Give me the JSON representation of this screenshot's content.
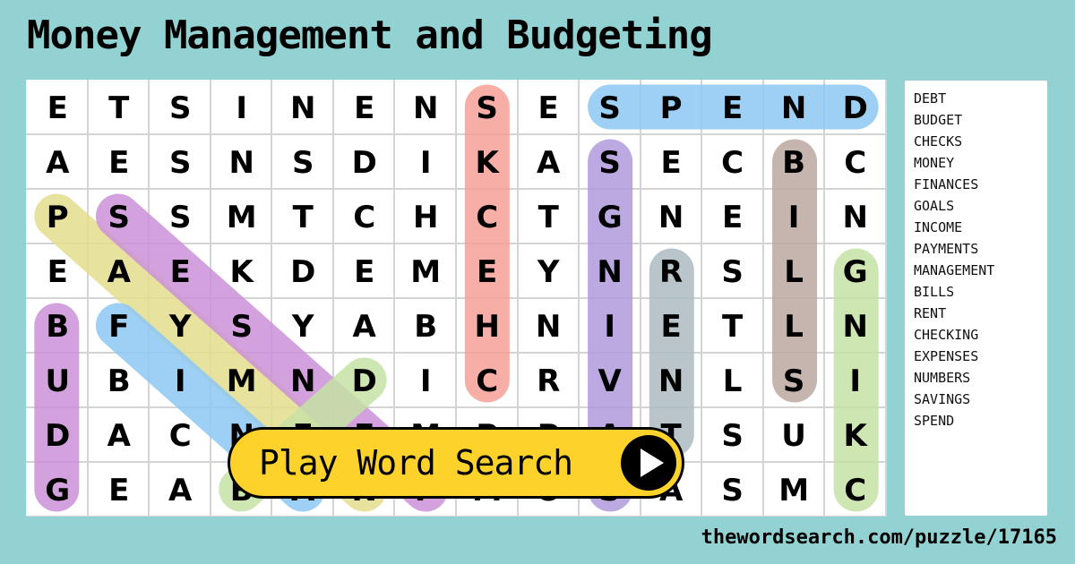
{
  "title": "Money Management and Budgeting",
  "grid": {
    "rows": [
      [
        "E",
        "T",
        "S",
        "I",
        "N",
        "E",
        "N",
        "S",
        "E",
        "S",
        "P",
        "E",
        "N",
        "D"
      ],
      [
        "A",
        "E",
        "S",
        "N",
        "S",
        "D",
        "I",
        "K",
        "A",
        "S",
        "E",
        "C",
        "B",
        "C"
      ],
      [
        "P",
        "S",
        "S",
        "M",
        "T",
        "C",
        "H",
        "C",
        "T",
        "G",
        "N",
        "E",
        "I",
        "N"
      ],
      [
        "E",
        "A",
        "E",
        "K",
        "D",
        "E",
        "M",
        "E",
        "Y",
        "N",
        "R",
        "S",
        "L",
        "G"
      ],
      [
        "B",
        "F",
        "Y",
        "S",
        "Y",
        "A",
        "B",
        "H",
        "N",
        "I",
        "E",
        "T",
        "L",
        "N"
      ],
      [
        "U",
        "B",
        "I",
        "M",
        "N",
        "D",
        "I",
        "C",
        "R",
        "V",
        "N",
        "L",
        "S",
        "I"
      ],
      [
        "D",
        "A",
        "C",
        "N",
        "E",
        "E",
        "M",
        "P",
        "P",
        "A",
        "T",
        "S",
        "U",
        "K"
      ],
      [
        "G",
        "E",
        "A",
        "B",
        "A",
        "N",
        "P",
        "M",
        "O",
        "S",
        "A",
        "S",
        "M",
        "C"
      ]
    ]
  },
  "found_words": [
    {
      "word": "SPEND",
      "color": "#8ec8f4",
      "start": [
        0,
        9
      ],
      "end": [
        0,
        13
      ]
    },
    {
      "word": "CHECKS",
      "color": "#f6a097",
      "start": [
        0,
        7
      ],
      "end": [
        5,
        7
      ]
    },
    {
      "word": "SAVINGS",
      "color": "#b19bdc",
      "start": [
        1,
        9
      ],
      "end": [
        7,
        9
      ]
    },
    {
      "word": "BILLS",
      "color": "#bca9a1",
      "start": [
        1,
        12
      ],
      "end": [
        5,
        12
      ]
    },
    {
      "word": "RENT",
      "color": "#adbcc3",
      "start": [
        3,
        10
      ],
      "end": [
        6,
        10
      ]
    },
    {
      "word": "CHECKING",
      "color": "#c6e2a5",
      "start": [
        3,
        13
      ],
      "end": [
        7,
        13
      ]
    },
    {
      "word": "BUDGET",
      "color": "#cc91d8",
      "start": [
        4,
        0
      ],
      "end": [
        7,
        0
      ]
    },
    {
      "word": "PAYMENTS",
      "color": "#e5de8f",
      "start": [
        2,
        0
      ],
      "end": [
        7,
        5
      ]
    },
    {
      "word": "EXPENSES",
      "color": "#cc91d8",
      "start": [
        2,
        1
      ],
      "end": [
        7,
        6
      ]
    },
    {
      "word": "FINANCES",
      "color": "#8ec8f4",
      "start": [
        4,
        1
      ],
      "end": [
        7,
        4
      ]
    },
    {
      "word": "DEBT",
      "color": "#c6e2a5",
      "start": [
        5,
        5
      ],
      "end": [
        7,
        3
      ]
    }
  ],
  "word_list": [
    "DEBT",
    "BUDGET",
    "CHECKS",
    "MONEY",
    "FINANCES",
    "GOALS",
    "INCOME",
    "PAYMENTS",
    "MANAGEMENT",
    "BILLS",
    "RENT",
    "CHECKING",
    "EXPENSES",
    "NUMBERS",
    "SAVINGS",
    "SPEND"
  ],
  "play_button": {
    "label": "Play Word Search",
    "icon": "play-icon"
  },
  "footer": {
    "url": "thewordsearch.com/puzzle/17165"
  }
}
